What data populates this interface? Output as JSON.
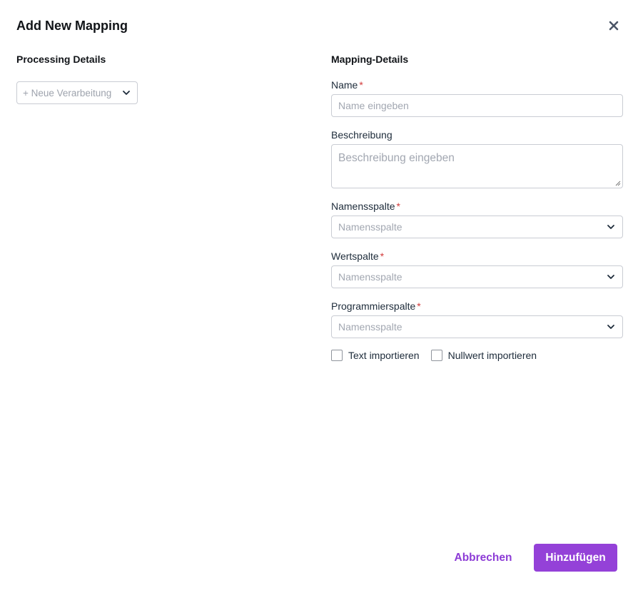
{
  "dialog": {
    "title": "Add New Mapping",
    "close_icon": "close-icon"
  },
  "processing": {
    "heading": "Processing Details",
    "select_placeholder": "+ Neue Verarbeitung"
  },
  "mapping": {
    "heading": "Mapping-Details",
    "name": {
      "label": "Name",
      "required": "*",
      "placeholder": "Name eingeben"
    },
    "description": {
      "label": "Beschreibung",
      "placeholder": "Beschreibung eingeben"
    },
    "name_column": {
      "label": "Namensspalte",
      "required": "*",
      "placeholder": "Namensspalte"
    },
    "value_column": {
      "label": "Wertspalte",
      "required": "*",
      "placeholder": "Namensspalte"
    },
    "programming_column": {
      "label": "Programmierspalte",
      "required": "*",
      "placeholder": "Namensspalte"
    },
    "checkboxes": {
      "import_text": "Text importieren",
      "import_null": "Nullwert importieren"
    }
  },
  "footer": {
    "cancel_label": "Abbrechen",
    "add_label": "Hinzufügen"
  },
  "colors": {
    "accent": "#9441d8",
    "required": "#d33b3b",
    "border": "#c9ccd3"
  }
}
